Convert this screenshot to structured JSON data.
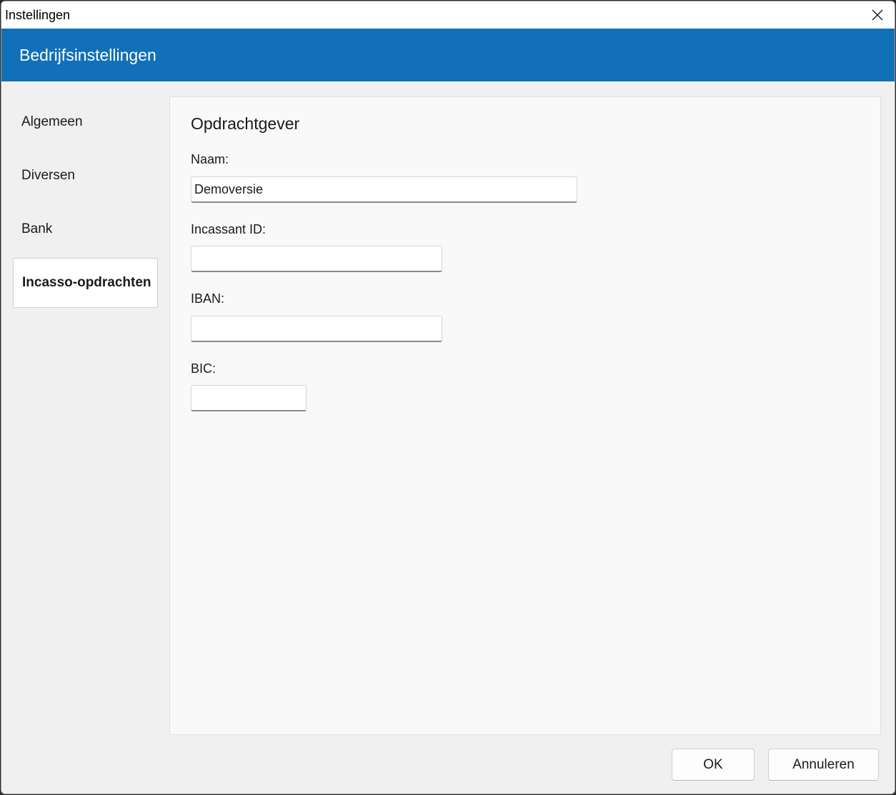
{
  "window": {
    "title": "Instellingen",
    "close_icon": "close-icon"
  },
  "header": {
    "title": "Bedrijfsinstellingen",
    "color": "#1170b7"
  },
  "sidebar": {
    "items": [
      {
        "label": "Algemeen",
        "active": false
      },
      {
        "label": "Diversen",
        "active": false
      },
      {
        "label": "Bank",
        "active": false
      },
      {
        "label": "Incasso-opdrachten",
        "active": true
      }
    ]
  },
  "main": {
    "section_title": "Opdrachtgever",
    "fields": {
      "naam": {
        "label": "Naam:",
        "value": "Demoversie"
      },
      "incassant_id": {
        "label": "Incassant ID:",
        "value": ""
      },
      "iban": {
        "label": "IBAN:",
        "value": ""
      },
      "bic": {
        "label": "BIC:",
        "value": ""
      }
    }
  },
  "footer": {
    "ok_label": "OK",
    "cancel_label": "Annuleren"
  }
}
